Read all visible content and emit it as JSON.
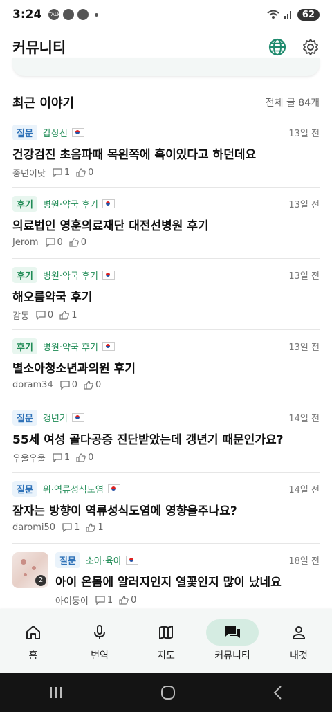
{
  "status": {
    "time": "3:24",
    "battery": "62",
    "notif1": "TALK"
  },
  "appbar": {
    "title": "커뮤니티"
  },
  "section": {
    "heading": "최근 이야기",
    "total": "전체 글 84개"
  },
  "posts": [
    {
      "badge": "질문",
      "badge_type": "q",
      "category": "갑상선",
      "date": "13일 전",
      "title": "건강검진 초음파때 목왼쪽에 혹이있다고 하던데요",
      "author": "중년이닷",
      "comments": "1",
      "likes": "0"
    },
    {
      "badge": "후기",
      "badge_type": "r",
      "category": "병원·약국 후기",
      "date": "13일 전",
      "title": "의료법인 영훈의료재단 대전선병원 후기",
      "author": "Jerom",
      "comments": "0",
      "likes": "0"
    },
    {
      "badge": "후기",
      "badge_type": "r",
      "category": "병원·약국 후기",
      "date": "13일 전",
      "title": "해오름약국 후기",
      "author": "감동",
      "comments": "0",
      "likes": "1"
    },
    {
      "badge": "후기",
      "badge_type": "r",
      "category": "병원·약국 후기",
      "date": "13일 전",
      "title": "별소아청소년과의원 후기",
      "author": "doram34",
      "comments": "0",
      "likes": "0"
    },
    {
      "badge": "질문",
      "badge_type": "q",
      "category": "갱년기",
      "date": "14일 전",
      "title": "55세 여성 골다공증 진단받았는데 갱년기 때문인가요?",
      "author": "우울우울",
      "comments": "1",
      "likes": "0"
    },
    {
      "badge": "질문",
      "badge_type": "q",
      "category": "위·역류성식도염",
      "date": "14일 전",
      "title": "잠자는 방향이 역류성식도염에 영향을주나요?",
      "author": "daromi50",
      "comments": "1",
      "likes": "1"
    },
    {
      "badge": "질문",
      "badge_type": "q",
      "category": "소아·육아",
      "date": "18일 전",
      "title": "아이 온몸에 알러지인지 열꽃인지 많이 났네요",
      "author": "아이둥이",
      "comments": "1",
      "likes": "0",
      "image_count": "2"
    }
  ],
  "nav": [
    {
      "label": "홈",
      "icon": "home-icon"
    },
    {
      "label": "번역",
      "icon": "mic-icon"
    },
    {
      "label": "지도",
      "icon": "map-icon"
    },
    {
      "label": "커뮤니티",
      "icon": "chat-icon",
      "active": true
    },
    {
      "label": "내것",
      "icon": "person-icon"
    }
  ],
  "colors": {
    "accent": "#1f8b55",
    "question": "#2f72b8",
    "active_nav": "#d5ece2"
  }
}
